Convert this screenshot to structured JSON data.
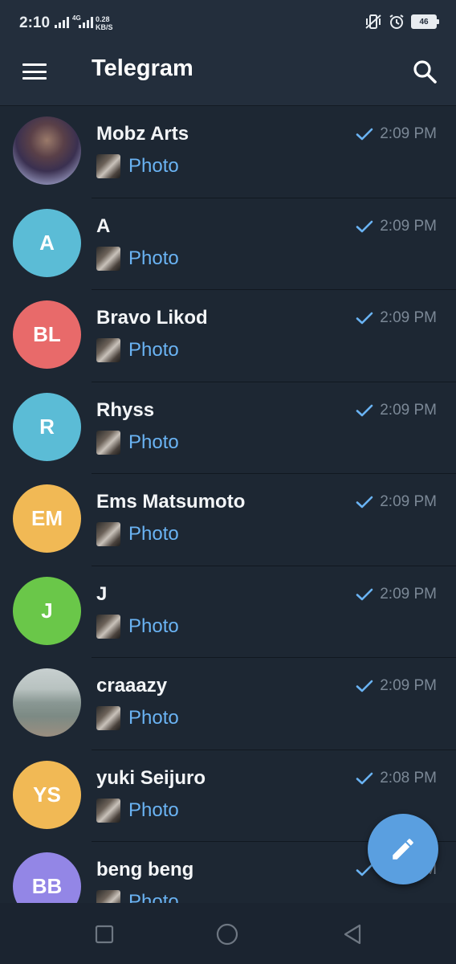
{
  "status_bar": {
    "time": "2:10",
    "network": "4G",
    "speed_value": "0.28",
    "speed_unit": "KB/S",
    "battery": "46"
  },
  "header": {
    "title": "Telegram",
    "menu_icon": "hamburger-menu-icon",
    "search_icon": "search-icon"
  },
  "chats": [
    {
      "name": "Mobz Arts",
      "initials": "",
      "avatar_color": "#7a6a8a",
      "avatar_type": "photo-portrait",
      "preview": "Photo",
      "time": "2:09 PM",
      "status": "sent"
    },
    {
      "name": "A",
      "initials": "A",
      "avatar_color": "#5bbcd6",
      "preview": "Photo",
      "time": "2:09 PM",
      "status": "sent"
    },
    {
      "name": "Bravo Likod",
      "initials": "BL",
      "avatar_color": "#e86a6a",
      "preview": "Photo",
      "time": "2:09 PM",
      "status": "sent"
    },
    {
      "name": "Rhyss",
      "initials": "R",
      "avatar_color": "#5bbcd6",
      "preview": "Photo",
      "time": "2:09 PM",
      "status": "sent"
    },
    {
      "name": "Ems Matsumoto",
      "initials": "EM",
      "avatar_color": "#f1b955",
      "preview": "Photo",
      "time": "2:09 PM",
      "status": "sent"
    },
    {
      "name": "J",
      "initials": "J",
      "avatar_color": "#6ac749",
      "preview": "Photo",
      "time": "2:09 PM",
      "status": "sent"
    },
    {
      "name": "craaazy",
      "initials": "",
      "avatar_color": "#8e9a96",
      "avatar_type": "photo-beach",
      "preview": "Photo",
      "time": "2:09 PM",
      "status": "sent"
    },
    {
      "name": "yuki Seijuro",
      "initials": "YS",
      "avatar_color": "#f1b955",
      "preview": "Photo",
      "time": "2:08 PM",
      "status": "sent"
    },
    {
      "name": "beng beng",
      "initials": "BB",
      "avatar_color": "#9386e6",
      "preview": "Photo",
      "time": "2:08 PM",
      "status": "sent"
    }
  ],
  "fab": {
    "icon": "pencil-icon"
  },
  "nav": {
    "icons": [
      "recent-apps-icon",
      "home-icon",
      "back-icon"
    ]
  },
  "colors": {
    "accent": "#6ab3f3",
    "background": "#1d2733",
    "header": "#232e3c",
    "fab": "#5a9fe0"
  }
}
